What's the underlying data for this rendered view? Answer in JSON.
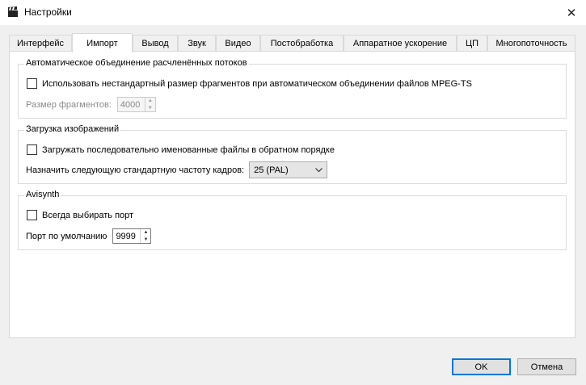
{
  "window": {
    "title": "Настройки",
    "close_glyph": "✕",
    "app_icon": "clapperboard-icon"
  },
  "tabs": [
    {
      "label": "Интерфейс",
      "active": false
    },
    {
      "label": "Импорт",
      "active": true
    },
    {
      "label": "Вывод",
      "active": false
    },
    {
      "label": "Звук",
      "active": false
    },
    {
      "label": "Видео",
      "active": false
    },
    {
      "label": "Постобработка",
      "active": false
    },
    {
      "label": "Аппаратное ускорение",
      "active": false
    },
    {
      "label": "ЦП",
      "active": false
    },
    {
      "label": "Многопоточность",
      "active": false
    }
  ],
  "groups": {
    "split_streams": {
      "title": "Автоматическое объединение расчленённых потоков",
      "custom_size_checkbox": {
        "label": "Использовать нестандартный размер фрагментов при автоматическом объединении файлов MPEG-TS",
        "checked": false
      },
      "fragment_size": {
        "label": "Размер фрагментов:",
        "value": "4000",
        "enabled": false
      }
    },
    "image_loading": {
      "title": "Загрузка изображений",
      "reverse_order_checkbox": {
        "label": "Загружать последовательно именованные файлы в обратном порядке",
        "checked": false
      },
      "frame_rate": {
        "label": "Назначить следующую стандартную частоту кадров:",
        "value": "25 (PAL)"
      }
    },
    "avisynth": {
      "title": "Avisynth",
      "always_port_checkbox": {
        "label": "Всегда выбирать порт",
        "checked": false
      },
      "default_port": {
        "label": "Порт по умолчанию",
        "value": "9999"
      }
    }
  },
  "buttons": {
    "ok": "OK",
    "cancel": "Отмена"
  },
  "colors": {
    "default_button_border": "#0078d7",
    "panel_background": "#ffffff",
    "window_background": "#f0f0f0"
  }
}
